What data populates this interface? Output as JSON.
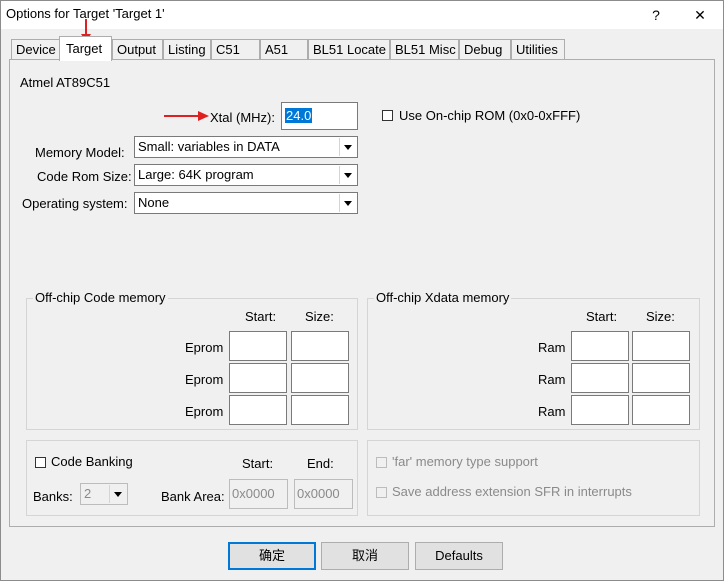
{
  "window": {
    "title": "Options for Target 'Target 1'",
    "help_label": "?",
    "close_label": "✕"
  },
  "tabs": [
    {
      "label": "Device"
    },
    {
      "label": "Target"
    },
    {
      "label": "Output"
    },
    {
      "label": "Listing"
    },
    {
      "label": "C51"
    },
    {
      "label": "A51"
    },
    {
      "label": "BL51 Locate"
    },
    {
      "label": "BL51 Misc"
    },
    {
      "label": "Debug"
    },
    {
      "label": "Utilities"
    }
  ],
  "active_tab": "Target",
  "target": {
    "device_name": "Atmel AT89C51",
    "xtal_label": "Xtal (MHz):",
    "xtal_value": "24.0",
    "onchip_rom_label": "Use On-chip ROM (0x0-0xFFF)",
    "memory_model_label": "Memory Model:",
    "memory_model_value": "Small: variables in DATA",
    "code_rom_label": "Code Rom Size:",
    "code_rom_value": "Large: 64K program",
    "os_label": "Operating system:",
    "os_value": "None"
  },
  "code_memory": {
    "title": "Off-chip Code memory",
    "start_header": "Start:",
    "size_header": "Size:",
    "rows": [
      {
        "label": "Eprom"
      },
      {
        "label": "Eprom"
      },
      {
        "label": "Eprom"
      }
    ]
  },
  "xdata_memory": {
    "title": "Off-chip Xdata memory",
    "start_header": "Start:",
    "size_header": "Size:",
    "rows": [
      {
        "label": "Ram"
      },
      {
        "label": "Ram"
      },
      {
        "label": "Ram"
      }
    ]
  },
  "banking": {
    "code_banking_label": "Code Banking",
    "start_header": "Start:",
    "end_header": "End:",
    "banks_label": "Banks:",
    "banks_value": "2",
    "bank_area_label": "Bank Area:",
    "bank_area_start": "0x0000",
    "bank_area_end": "0x0000",
    "far_memory_label": "'far' memory type support",
    "save_sfr_label": "Save address extension SFR in interrupts"
  },
  "buttons": {
    "ok": "确定",
    "cancel": "取消",
    "defaults": "Defaults"
  },
  "colors": {
    "accent": "#0078d7",
    "annotation_arrow": "#e02020"
  }
}
